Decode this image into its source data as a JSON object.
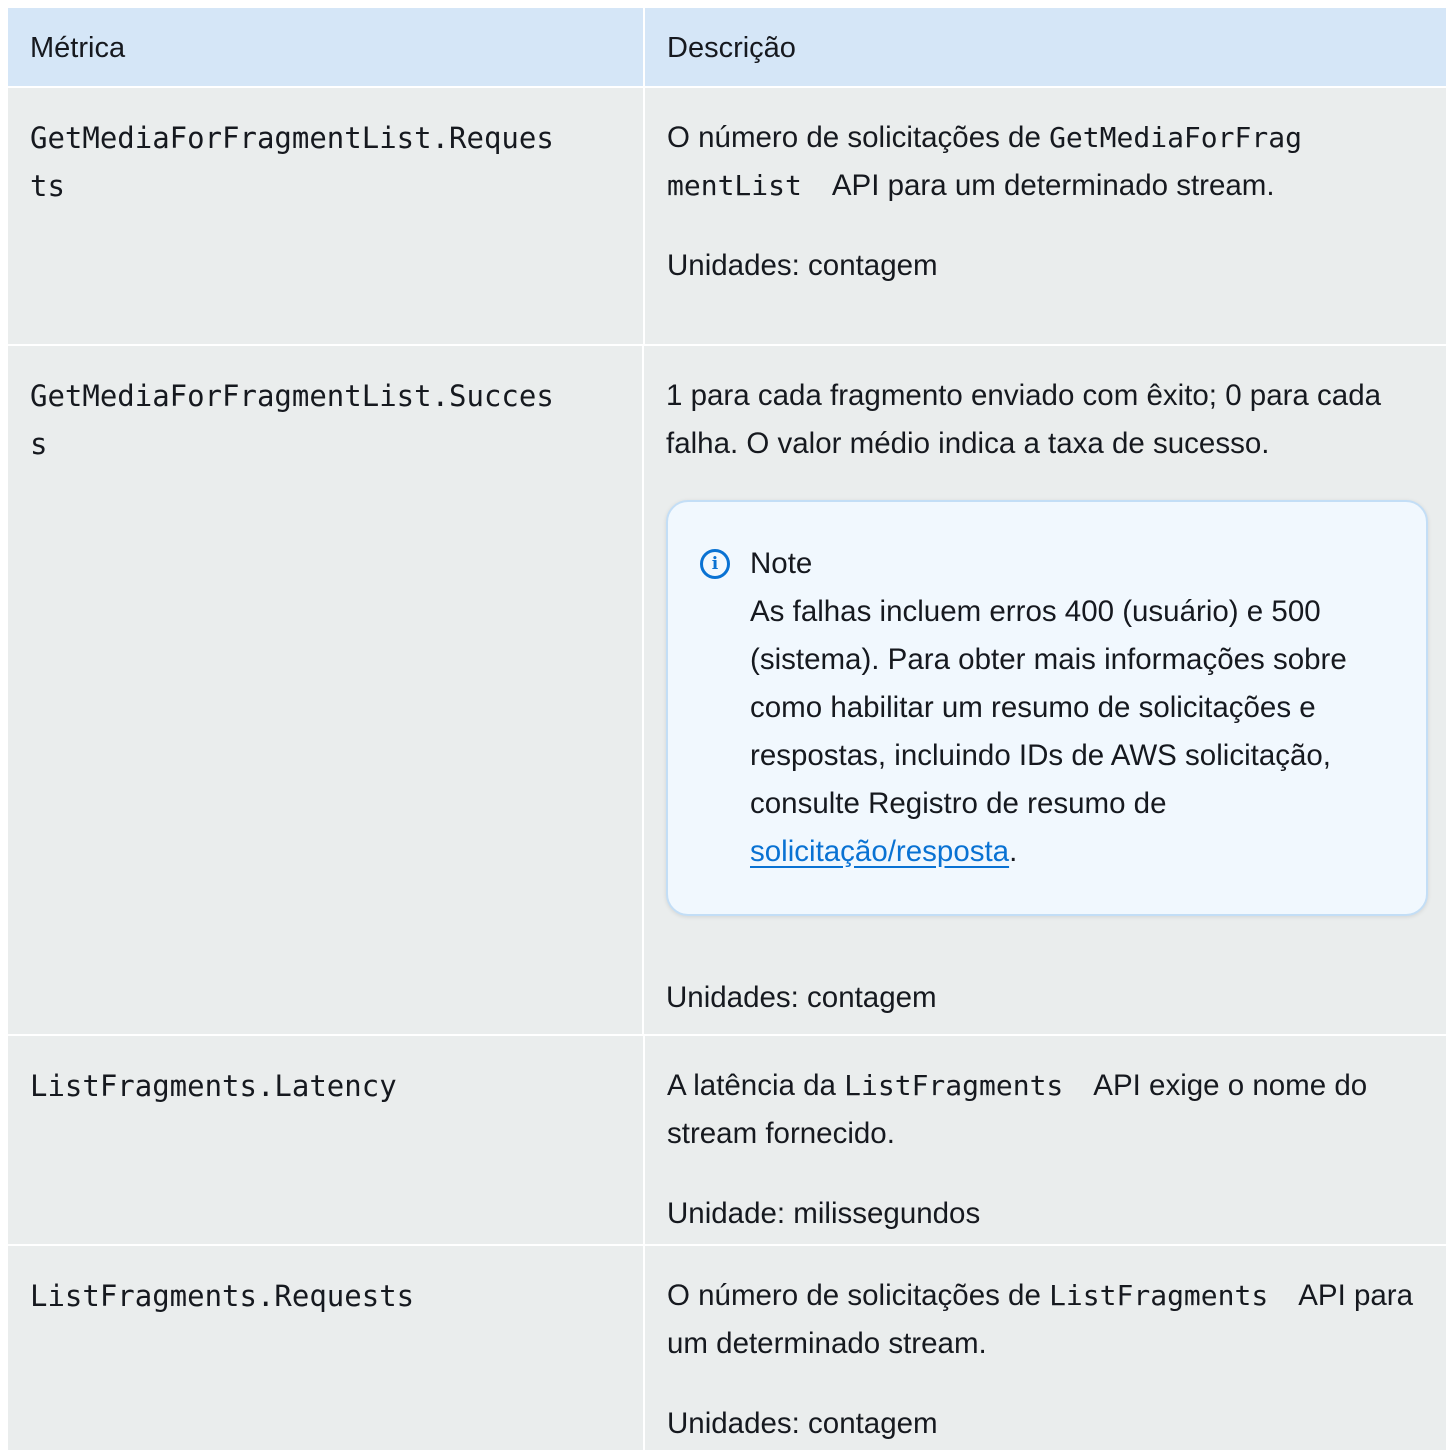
{
  "header": {
    "metric_label": "Métrica",
    "description_label": "Descrição"
  },
  "rows": [
    {
      "metric": "GetMediaForFragmentList.Requests",
      "desc_prefix": "O número de solicitações de ",
      "desc_code": "GetMediaForFragmentList",
      "desc_suffix": "API para um determinado stream.",
      "units": "Unidades: contagem"
    },
    {
      "metric": "GetMediaForFragmentList.Success",
      "desc": "1 para cada fragmento enviado com êxito; 0 para cada falha. O valor médio indica a taxa de sucesso.",
      "note_title": "Note",
      "note_text": "As falhas incluem erros 400 (usuário) e 500 (sistema). Para obter mais informações sobre como habilitar um resumo de solicitações e respostas, incluindo IDs de AWS solicitação, consulte Registro de resumo de ",
      "note_link": "solicitação/resposta",
      "note_end": ".",
      "units": "Unidades: contagem"
    },
    {
      "metric": "ListFragments.Latency",
      "desc_prefix": "A latência da ",
      "desc_code": "ListFragments",
      "desc_suffix": "API exige o nome do stream fornecido.",
      "units": "Unidade: milissegundos"
    },
    {
      "metric": "ListFragments.Requests",
      "desc_prefix": "O número de solicitações de ",
      "desc_code": "ListFragments",
      "desc_suffix": "API para um determinado stream.",
      "units": "Unidades: contagem"
    }
  ],
  "icons": {
    "note_icon": "info-icon"
  },
  "colors": {
    "header_bg": "#d5e6f7",
    "row_bg": "#eaeded",
    "note_bg": "#f1f8fe",
    "link": "#0972d3"
  }
}
